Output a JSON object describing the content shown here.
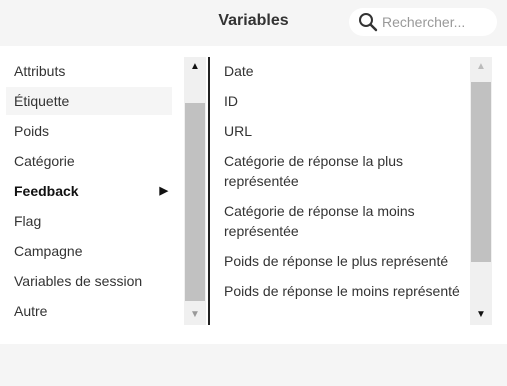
{
  "header": {
    "title": "Variables"
  },
  "search": {
    "placeholder": "Rechercher..."
  },
  "categories": [
    {
      "label": "Attributs"
    },
    {
      "label": "Étiquette"
    },
    {
      "label": "Poids"
    },
    {
      "label": "Catégorie"
    },
    {
      "label": "Feedback",
      "selected": true,
      "arrow": "▶"
    },
    {
      "label": "Flag"
    },
    {
      "label": "Campagne"
    },
    {
      "label": "Variables de session"
    },
    {
      "label": "Autre"
    }
  ],
  "variables": [
    {
      "label": "Date"
    },
    {
      "label": "ID"
    },
    {
      "label": "URL"
    },
    {
      "label": "Catégorie de réponse la plus représentée"
    },
    {
      "label": "Catégorie de réponse la moins représentée"
    },
    {
      "label": "Poids de réponse le plus représenté"
    },
    {
      "label": "Poids de réponse le moins représenté"
    }
  ],
  "scrollbars": {
    "up_glyph": "▲",
    "down_glyph": "▼"
  },
  "icons": {
    "search": "search-icon",
    "arrow": "triangle-right-icon"
  }
}
